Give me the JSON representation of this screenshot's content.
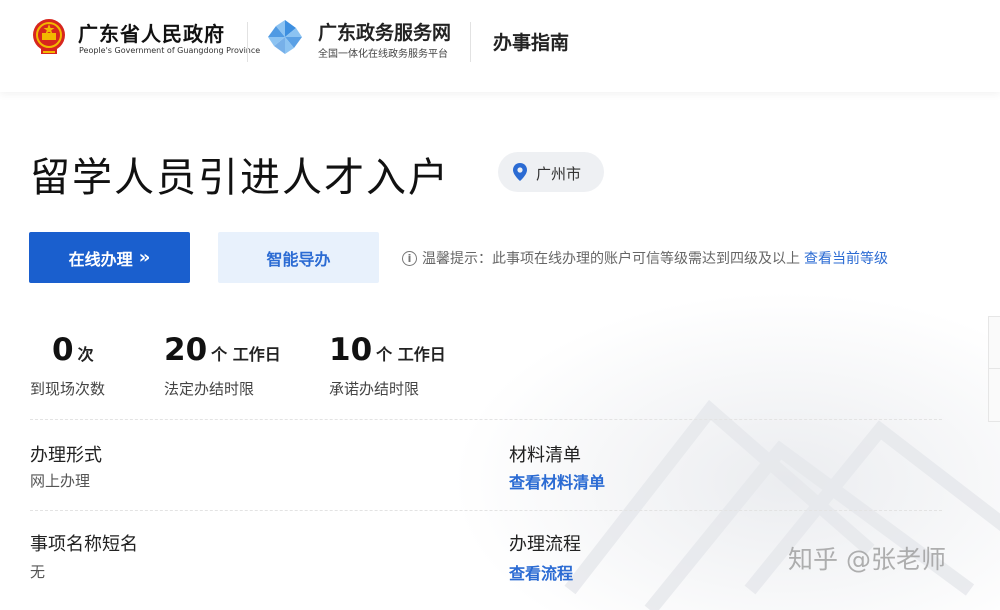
{
  "header": {
    "gov_title": "广东省人民政府",
    "gov_subtitle": "People's Government of Guangdong Province",
    "service_title": "广东政务服务网",
    "service_subtitle": "全国一体化在线政务服务平台",
    "guide_label": "办事指南"
  },
  "item": {
    "title": "留学人员引进人才入户",
    "location": "广州市"
  },
  "actions": {
    "online_label": "在线办理",
    "online_chevron": "»",
    "smart_label": "智能导办"
  },
  "tip": {
    "text": "温馨提示：此事项在线办理的账户可信等级需达到四级及以上",
    "link": "查看当前等级"
  },
  "stats": [
    {
      "value": "0",
      "unit": "次",
      "label": "到现场次数"
    },
    {
      "value": "20",
      "unit": "个 工作日",
      "label": "法定办结时限"
    },
    {
      "value": "10",
      "unit": "个 工作日",
      "label": "承诺办结时限"
    }
  ],
  "details": {
    "form_label": "办理形式",
    "form_value": "网上办理",
    "materials_label": "材料清单",
    "materials_link": "查看材料清单",
    "short_name_label": "事项名称短名",
    "short_name_value": "无",
    "process_label": "办理流程",
    "process_link": "查看流程"
  },
  "watermark": "知乎 @张老师",
  "colors": {
    "primary": "#1a5fce",
    "link": "#2b6bd3",
    "smart_bg": "#e8f1fc",
    "emblem_red": "#d7261e",
    "emblem_gold": "#f2b800",
    "pinwheel_blue": "#3d8fe0"
  },
  "icons": {
    "emblem": "national-emblem-icon",
    "pinwheel": "pinwheel-logo-icon",
    "location": "location-pin-icon",
    "info": "info-icon"
  }
}
